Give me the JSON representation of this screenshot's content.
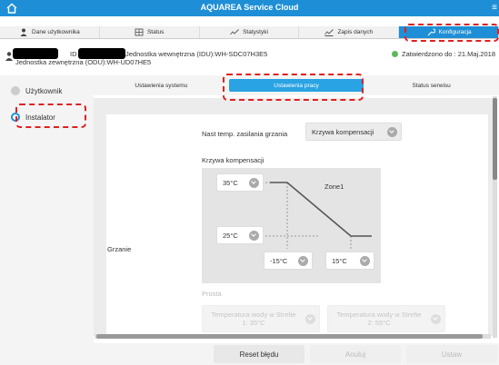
{
  "app": {
    "title": "AQUAREA Service Cloud"
  },
  "nav_tabs": [
    {
      "label": "Dane użytkownika",
      "icon": "person-icon"
    },
    {
      "label": "Status",
      "icon": "grid-icon"
    },
    {
      "label": "Statystyki",
      "icon": "chart-icon"
    },
    {
      "label": "Zapis danych",
      "icon": "log-icon"
    },
    {
      "label": "Konfiguracja",
      "icon": "wrench-icon"
    }
  ],
  "device": {
    "id_label": "ID",
    "indoor_unit": "Jednostka wewnętrzna (IDU):WH-SDC07H3E5",
    "outdoor_unit": "Jednostka zewnętrzna (ODU):WH-UD07HE5",
    "approval": "Zatwierdzono do : 21.Maj.2018"
  },
  "sidebar": {
    "items": [
      {
        "label": "Użytkownik"
      },
      {
        "label": "Instalator"
      }
    ]
  },
  "subtabs": [
    {
      "label": "Ustawienia systemu"
    },
    {
      "label": "Ustawienia pracy"
    },
    {
      "label": "Status serwisu"
    }
  ],
  "form": {
    "supply_label": "Nast temp. zasilania grzania",
    "supply_value": "Krzywa kompensacji",
    "curve_title": "Krzywa kompensacji",
    "section_label": "Grzanie",
    "zone": "Zone1",
    "temp_high_water": "35°C",
    "temp_low_water": "25°C",
    "outdoor_low": "-15°C",
    "outdoor_high": "15°C",
    "simple_label": "Prosta",
    "zone1_water": "Temperatura wody w Strefie 1: 35°C",
    "zone2_water": "Temperatura wody w Strefie 2: 55°C"
  },
  "buttons": {
    "reset": "Reset błędu",
    "cancel": "Anuluj",
    "apply": "Ustaw"
  },
  "colors": {
    "accent": "#1e8fd6",
    "highlight": "#e02020",
    "status_ok": "#5cb85c"
  }
}
